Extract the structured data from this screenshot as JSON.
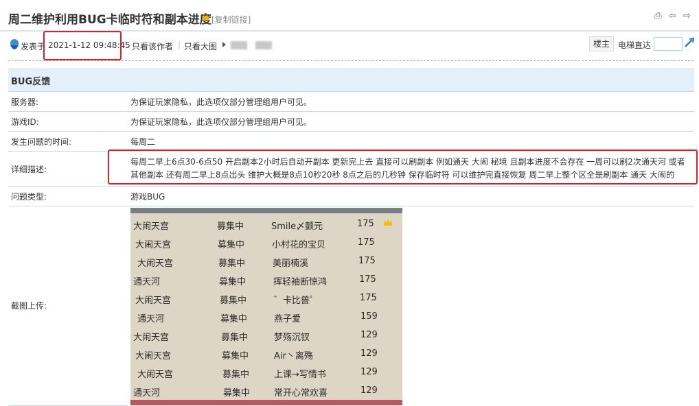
{
  "thread": {
    "title": "周二维护利用BUG卡临时符和副本进度",
    "copy_link": "[复制链接]"
  },
  "meta": {
    "posted_label": "发表于",
    "date": "2021-1-12 09:48:45",
    "only_author": "只看该作者",
    "only_images": "只看大图",
    "floor_label": "楼主",
    "elevator_label": "电梯直达"
  },
  "form": {
    "section_title": "BUG反馈",
    "rows": [
      {
        "label": "服务器:",
        "value": "为保证玩家隐私，此选项仅部分管理组用户可见。"
      },
      {
        "label": "游戏ID:",
        "value": "为保证玩家隐私，此选项仅部分管理组用户可见。"
      },
      {
        "label": "发生问题的时间:",
        "value": "每周二"
      },
      {
        "label": "详细描述:",
        "value": "每周二早上6点30-6点50 开启副本2小时后自动开副本 更新完上去 直接可以刷副本 例如通天 大闹 秘境 且副本进度不会存在 一周可以刷2次通天河 或者其他副本 还有周二早上8点出头 维护大概是8点10秒20秒 8点之后的几秒钟 保存临时符 可以维护完直接恢复 周二早上整个区全是刷副本 通天 大闹的"
      },
      {
        "label": "问题类型:",
        "value": "游戏BUG"
      },
      {
        "label": "截图上传:",
        "value": ""
      }
    ]
  },
  "screenshot_rows": [
    {
      "name": "大闹天宫",
      "status": "募集中",
      "leader": "Smile〆颤元",
      "level": "175"
    },
    {
      "name": "大闹天宫",
      "status": "募集中",
      "leader": "小村花的宝贝",
      "level": "175"
    },
    {
      "name": "大闹天宫",
      "status": "募集中",
      "leader": "美丽楠溪",
      "level": "175"
    },
    {
      "name": "通天河",
      "status": "募集中",
      "leader": "挥轻袖断惊鸿",
      "level": "175"
    },
    {
      "name": "大闹天宫",
      "status": "募集中",
      "leader": "゛卡比兽゜",
      "level": "175"
    },
    {
      "name": "通天河",
      "status": "募集中",
      "leader": "燕子爱",
      "level": "159"
    },
    {
      "name": "大闹天宫",
      "status": "募集中",
      "leader": "梦殇沉钗",
      "level": "129"
    },
    {
      "name": "大闹天宫",
      "status": "募集中",
      "leader": "Air丶离殇",
      "level": "129"
    },
    {
      "name": "大闹天宫",
      "status": "募集中",
      "leader": "上课→写情书",
      "level": "129"
    },
    {
      "name": "通天河",
      "status": "募集中",
      "leader": "常开心常欢喜",
      "level": "129"
    }
  ],
  "colors": {
    "accent": "#e3f0f9",
    "highlight": "#e02020"
  },
  "icons": [
    "lock-icon",
    "print-icon",
    "prev-icon",
    "next-icon",
    "avatar-icon",
    "elevator-go-icon",
    "crown-icon"
  ]
}
